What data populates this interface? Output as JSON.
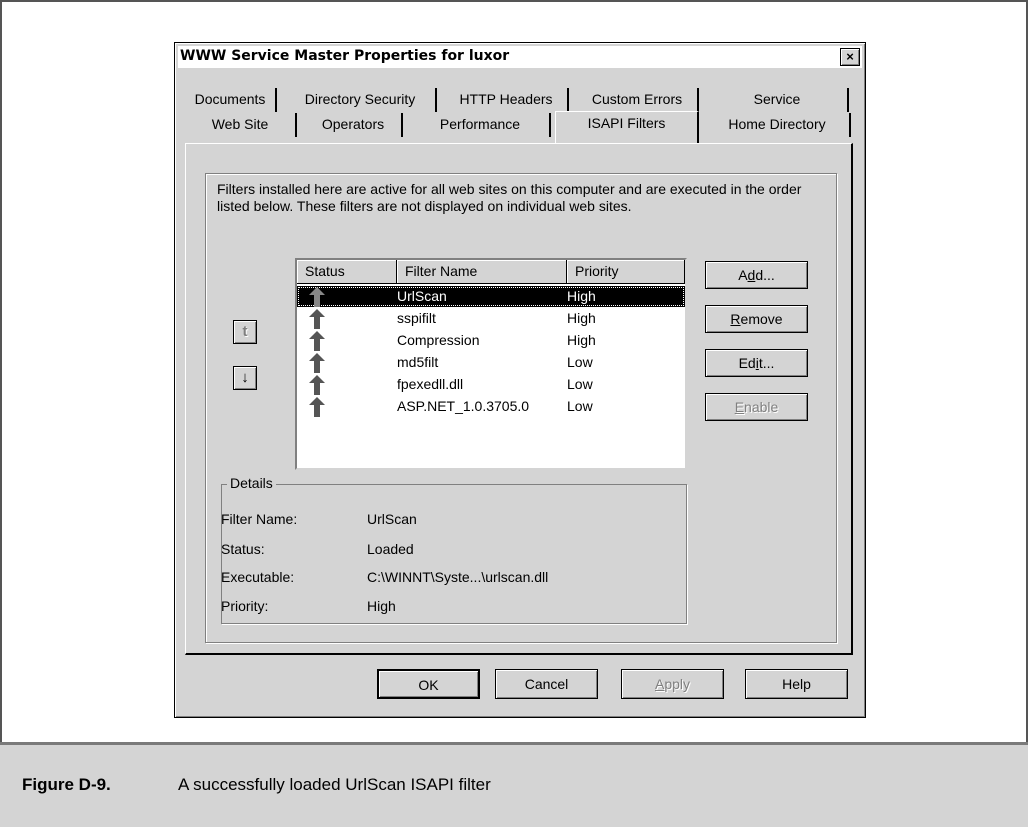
{
  "dialog": {
    "title": "WWW Service Master Properties for luxor",
    "close_label": "×"
  },
  "tabs": {
    "row1": [
      "Documents",
      "Directory Security",
      "HTTP Headers",
      "Custom Errors",
      "Service"
    ],
    "row2": [
      "Web Site",
      "Operators",
      "Performance",
      "ISAPI Filters",
      "Home Directory"
    ],
    "active": "ISAPI Filters"
  },
  "isapi": {
    "description": "Filters installed here are active for all web sites on this computer and are executed in the order listed below.  These filters are not displayed on individual web sites.",
    "columns": [
      "Status",
      "Filter Name",
      "Priority"
    ],
    "filters": [
      {
        "name": "UrlScan",
        "priority": "High",
        "status_icon": "up-arrow-icon",
        "selected": true
      },
      {
        "name": "sspifilt",
        "priority": "High",
        "status_icon": "up-arrow-icon",
        "selected": false
      },
      {
        "name": "Compression",
        "priority": "High",
        "status_icon": "up-arrow-icon",
        "selected": false
      },
      {
        "name": "md5filt",
        "priority": "Low",
        "status_icon": "up-arrow-icon",
        "selected": false
      },
      {
        "name": "fpexedll.dll",
        "priority": "Low",
        "status_icon": "up-arrow-icon",
        "selected": false
      },
      {
        "name": "ASP.NET_1.0.3705.0",
        "priority": "Low",
        "status_icon": "up-arrow-icon",
        "selected": false
      }
    ],
    "move_up_label": "t",
    "move_down_label": "↓",
    "buttons": {
      "add": {
        "pre": "A",
        "key": "d",
        "post": "d..."
      },
      "remove": {
        "pre": "",
        "key": "R",
        "post": "emove"
      },
      "edit": {
        "pre": "Ed",
        "key": "i",
        "post": "t..."
      },
      "enable": {
        "pre": "",
        "key": "E",
        "post": "nable"
      }
    },
    "details": {
      "legend": "Details",
      "rows": [
        {
          "label": "Filter Name:",
          "value": "UrlScan"
        },
        {
          "label": "Status:",
          "value": "Loaded"
        },
        {
          "label": "Executable:",
          "value": "C:\\WINNT\\Syste...\\urlscan.dll"
        },
        {
          "label": "Priority:",
          "value": "High"
        }
      ]
    }
  },
  "footer_buttons": {
    "ok": "OK",
    "cancel": "Cancel",
    "apply": {
      "key": "A",
      "post": "pply"
    },
    "help": "Help"
  },
  "caption": {
    "label": "Figure D-9.",
    "text": "A successfully loaded UrlScan ISAPI filter"
  },
  "colors": {
    "dialog_face": "#d4d4d4",
    "selection": "#000000",
    "disabled_text": "#808080",
    "status_arrow": "#555555"
  }
}
